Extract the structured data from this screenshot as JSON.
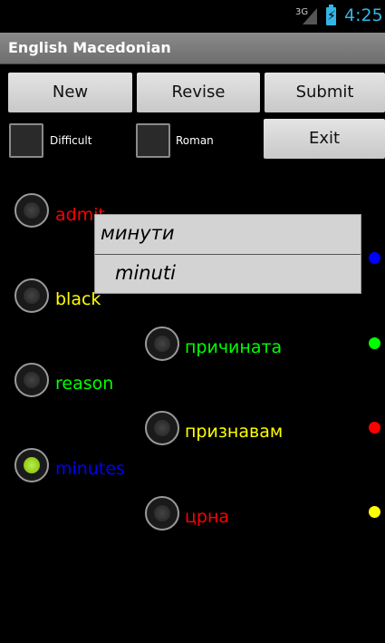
{
  "status": {
    "network": "3G",
    "time": "4:25"
  },
  "app": {
    "title": "English Macedonian"
  },
  "toolbar": {
    "new_label": "New",
    "revise_label": "Revise",
    "submit_label": "Submit",
    "exit_label": "Exit"
  },
  "options": {
    "difficult_label": "Difficult",
    "roman_label": "Roman"
  },
  "english_words": [
    {
      "text": "admit",
      "color": "#ff0000",
      "selected": false
    },
    {
      "text": "black",
      "color": "#ffff00",
      "selected": false
    },
    {
      "text": "reason",
      "color": "#00ff00",
      "selected": false
    },
    {
      "text": "minutes",
      "color": "#0000ff",
      "selected": true
    }
  ],
  "macedonian_words": [
    {
      "text": "причината",
      "color": "#00ff00"
    },
    {
      "text": "признавам",
      "color": "#ffff00"
    },
    {
      "text": "црна",
      "color": "#ff0000"
    }
  ],
  "indicator_dots": [
    "#0000ff",
    "#00ff00",
    "#ff0000",
    "#ffff00"
  ],
  "popup": {
    "cyrillic": "минути",
    "roman": "minuti"
  }
}
